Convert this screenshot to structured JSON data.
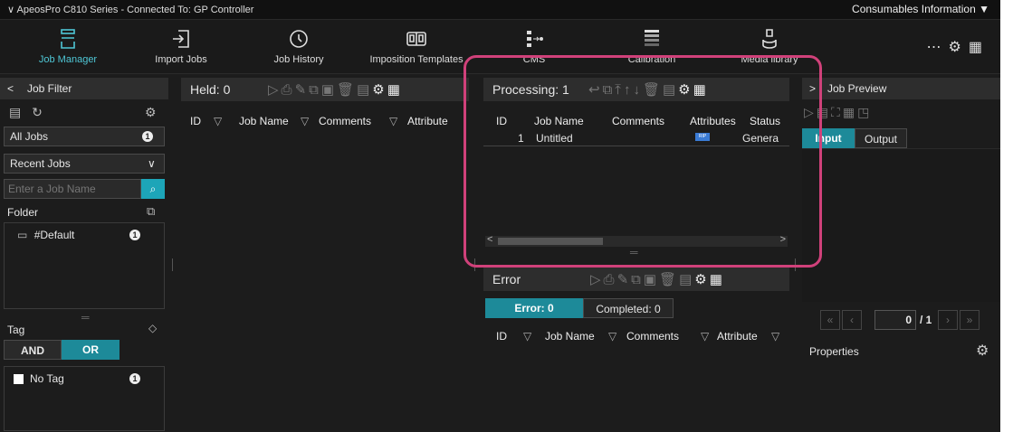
{
  "title": "ApeosPro C810 Series - Connected To: GP Controller",
  "consumables": "Consumables Information",
  "toolbar": [
    {
      "label": "Job Manager",
      "icon": "job-manager-icon",
      "active": true
    },
    {
      "label": "Import Jobs",
      "icon": "import-icon"
    },
    {
      "label": "Job History",
      "icon": "history-icon"
    },
    {
      "label": "Imposition Templates",
      "icon": "imposition-icon"
    },
    {
      "label": "CMS",
      "icon": "cms-icon"
    },
    {
      "label": "Calibration",
      "icon": "calibration-icon"
    },
    {
      "label": "Media library",
      "icon": "media-library-icon"
    }
  ],
  "left": {
    "header": "Job Filter",
    "all_jobs": "All Jobs",
    "all_jobs_count": "1",
    "recent_jobs": "Recent Jobs",
    "search_placeholder": "Enter a Job Name",
    "folder_label": "Folder",
    "folder_name": "#Default",
    "folder_count": "1",
    "tag_label": "Tag",
    "and": "AND",
    "or": "OR",
    "no_tag": "No Tag",
    "no_tag_count": "1"
  },
  "held": {
    "header": "Held: 0",
    "columns": [
      "ID",
      "Job Name",
      "Comments",
      "Attribute"
    ]
  },
  "processing": {
    "header": "Processing: 1",
    "columns": [
      "ID",
      "Job Name",
      "Comments",
      "Attributes",
      "Status"
    ],
    "rows": [
      {
        "id": "1",
        "name": "Untitled",
        "attr": "RIP",
        "status": "Genera"
      }
    ]
  },
  "error": {
    "header": "Error",
    "tab_error": "Error: 0",
    "tab_completed": "Completed: 0",
    "columns": [
      "ID",
      "Job Name",
      "Comments",
      "Attribute"
    ]
  },
  "preview": {
    "header": "Job Preview",
    "tab_input": "Input",
    "tab_output": "Output",
    "page": "0",
    "total": "/ 1",
    "properties": "Properties"
  },
  "colors": {
    "accent": "#1da5b8",
    "highlight": "#d0417a"
  }
}
